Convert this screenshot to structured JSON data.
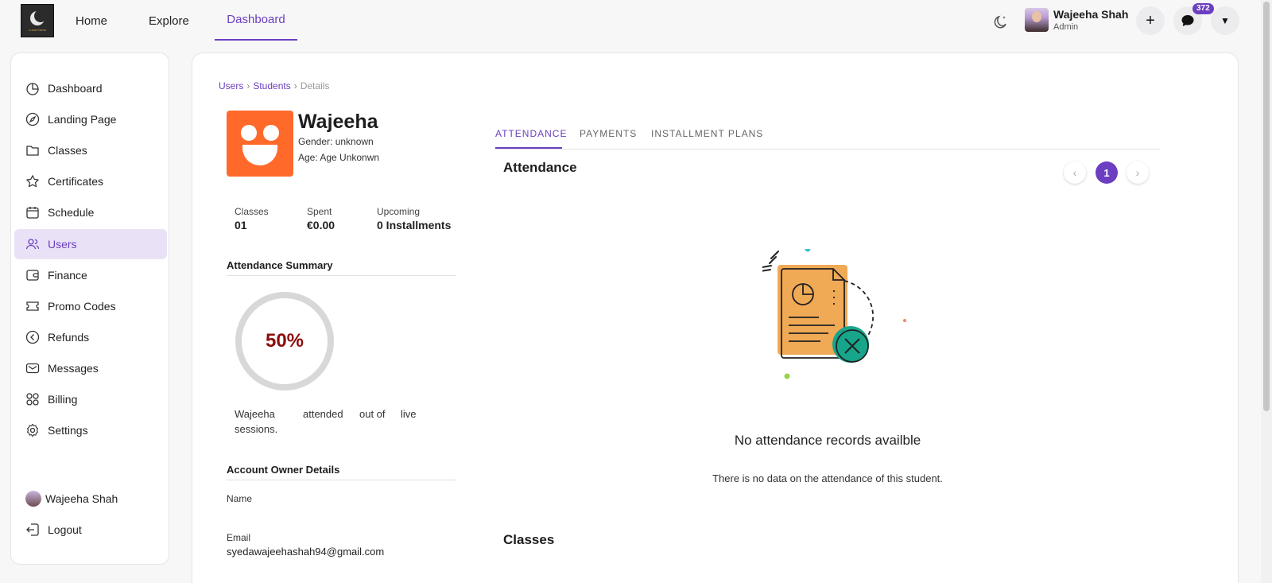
{
  "header": {
    "logo_text": "Lunar Kama",
    "nav": {
      "home": "Home",
      "explore": "Explore",
      "dashboard": "Dashboard"
    },
    "user": {
      "name": "Wajeeha Shah",
      "role": "Admin"
    },
    "chat_badge": "372",
    "plus_symbol": "+",
    "dropdown_symbol": "▼"
  },
  "sidebar": {
    "items": [
      {
        "label": "Dashboard",
        "icon": "pie-chart-icon"
      },
      {
        "label": "Landing Page",
        "icon": "compass-icon"
      },
      {
        "label": "Classes",
        "icon": "folder-icon"
      },
      {
        "label": "Certificates",
        "icon": "star-icon"
      },
      {
        "label": "Schedule",
        "icon": "calendar-icon"
      },
      {
        "label": "Users",
        "icon": "users-icon",
        "active": true
      },
      {
        "label": "Finance",
        "icon": "wallet-icon"
      },
      {
        "label": "Promo Codes",
        "icon": "ticket-icon"
      },
      {
        "label": "Refunds",
        "icon": "refund-icon"
      },
      {
        "label": "Messages",
        "icon": "mail-icon"
      },
      {
        "label": "Billing",
        "icon": "grid-icon"
      },
      {
        "label": "Settings",
        "icon": "gear-icon"
      }
    ],
    "user_name": "Wajeeha Shah",
    "logout": "Logout"
  },
  "breadcrumb": {
    "users": "Users",
    "students": "Students",
    "current": "Details",
    "sep": "›"
  },
  "profile": {
    "name": "Wajeeha",
    "gender": "Gender: unknown",
    "age": "Age: Age Unkonwn"
  },
  "stats": [
    {
      "label": "Classes",
      "value": "01"
    },
    {
      "label": "Spent",
      "value": "€0.00"
    },
    {
      "label": "Upcoming",
      "value": "0 Installments"
    }
  ],
  "attendance_summary": {
    "title": "Attendance Summary",
    "percent": "50%",
    "text_parts": [
      "Wajeeha",
      "attended",
      "out of",
      "live"
    ],
    "text_end": "sessions."
  },
  "account_owner": {
    "title": "Account Owner Details",
    "name_label": "Name",
    "email_label": "Email",
    "email": "syedawajeehashah94@gmail.com"
  },
  "tabs": [
    {
      "label": "ATTENDANCE",
      "active": true
    },
    {
      "label": "PAYMENTS"
    },
    {
      "label": "INSTALLMENT PLANS"
    }
  ],
  "attendance": {
    "title": "Attendance",
    "page": "1",
    "prev_symbol": "‹",
    "next_symbol": "›",
    "empty_title": "No attendance records availble",
    "empty_sub": "There is no data on the attendance of this student."
  },
  "classes_title": "Classes",
  "colors": {
    "accent": "#6b3fc0",
    "avatar_orange": "#ff6a2b",
    "percent_red": "#8b0d0d",
    "illus_teal": "#17a58b",
    "illus_orange": "#f0a955"
  }
}
